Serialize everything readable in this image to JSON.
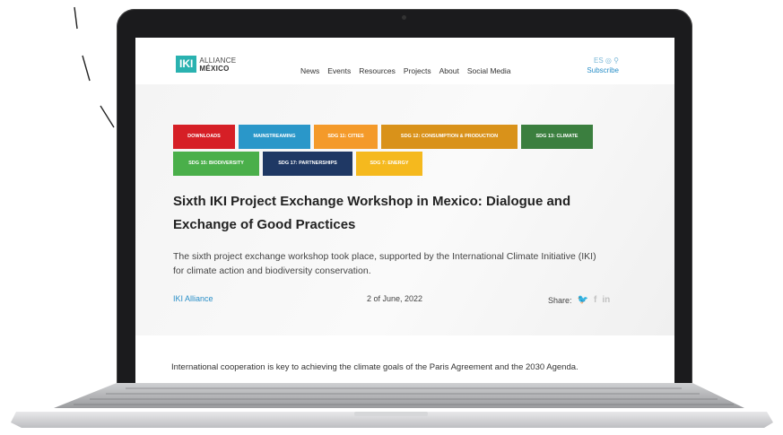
{
  "site": {
    "logo": {
      "mark": "IKI",
      "line1": "ALLIANCE",
      "line2": "MÉXICO"
    },
    "nav": [
      "News",
      "Events",
      "Resources",
      "Projects",
      "About",
      "Social Media"
    ],
    "lang": "ES",
    "subscribe": "Subscribe"
  },
  "article": {
    "tags": [
      {
        "label": "DOWNLOADS",
        "color": "#d61f26"
      },
      {
        "label": "MAINSTREAMING",
        "color": "#2a97c9"
      },
      {
        "label": "SDG 11: CITIES",
        "color": "#f49a2a"
      },
      {
        "label": "SDG 12: CONSUMPTION & PRODUCTION",
        "color": "#d9921a"
      },
      {
        "label": "SDG 13: CLIMATE",
        "color": "#3b7f3f"
      },
      {
        "label": "SDG 15: BIODIVERSITY",
        "color": "#4aaf4a"
      },
      {
        "label": "SDG 17: PARTNERSHIPS",
        "color": "#1f3864"
      },
      {
        "label": "SDG 7: ENERGY",
        "color": "#f5b91e"
      }
    ],
    "title": "Sixth IKI Project Exchange Workshop in Mexico: Dialogue and Exchange of Good Practices",
    "summary": "The sixth project exchange workshop took place, supported by the International Climate Initiative (IKI) for climate action and biodiversity conservation.",
    "author": "IKI Alliance",
    "date": "2 of June, 2022",
    "share_label": "Share:",
    "share_icons": [
      "twitter-icon",
      "facebook-icon",
      "linkedin-icon"
    ],
    "body": "International cooperation is key to achieving the climate goals of the Paris Agreement and the 2030 Agenda."
  }
}
